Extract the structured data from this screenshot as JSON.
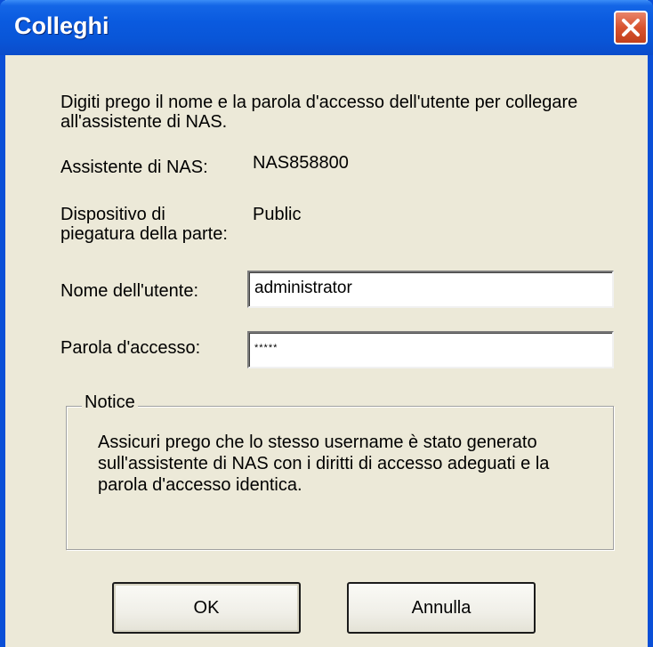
{
  "window": {
    "title": "Colleghi"
  },
  "instructions": "Digiti prego il nome e la parola d'accesso dell'utente per collegare\nall'assistente di NAS.",
  "nas": {
    "label": "Assistente di NAS:",
    "value": "NAS858800"
  },
  "share": {
    "label_line1": "Dispositivo di",
    "label_line2": "piegatura della parte:",
    "value": "Public"
  },
  "username": {
    "label": "Nome dell'utente:",
    "value": "administrator"
  },
  "password": {
    "label": "Parola d'accesso:",
    "value": "*****"
  },
  "notice": {
    "legend": "Notice",
    "text": "Assicuri prego che lo stesso username è stato generato\nsull'assistente di NAS con i diritti di accesso adeguati e la\nparola d'accesso identica."
  },
  "buttons": {
    "ok_label": "OK",
    "cancel_label": "Annulla"
  },
  "colors": {
    "titlebar": "#0a5adf",
    "close": "#d8532f",
    "dialog_bg": "#ece9d8"
  },
  "icons": {
    "close": "close-icon"
  }
}
